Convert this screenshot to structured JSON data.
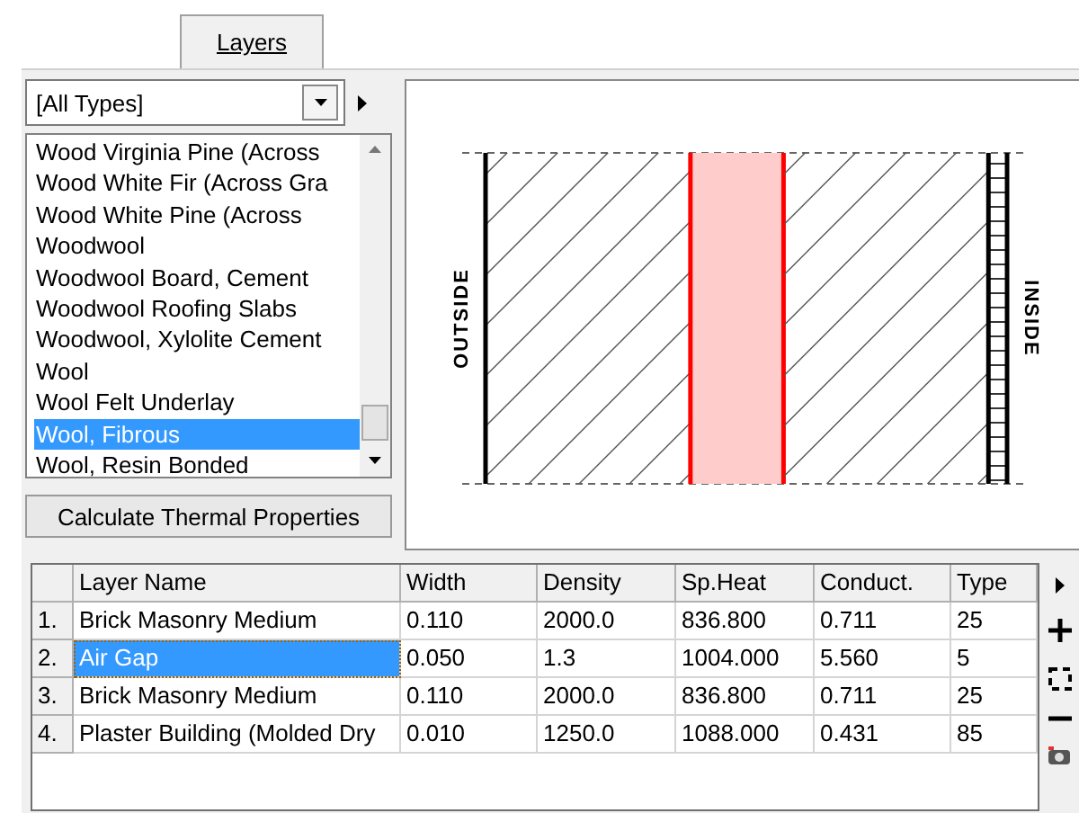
{
  "tabs": [
    {
      "label": "Layers",
      "selected": true
    }
  ],
  "type_filter": {
    "value": "[All Types]"
  },
  "materials": [
    {
      "label": "Wood Virginia Pine (Across",
      "selected": false
    },
    {
      "label": "Wood White Fir (Across Gra",
      "selected": false
    },
    {
      "label": "Wood White Pine (Across",
      "selected": false
    },
    {
      "label": "Woodwool",
      "selected": false
    },
    {
      "label": "Woodwool Board, Cement",
      "selected": false
    },
    {
      "label": "Woodwool Roofing Slabs",
      "selected": false
    },
    {
      "label": "Woodwool, Xylolite Cement",
      "selected": false
    },
    {
      "label": "Wool",
      "selected": false
    },
    {
      "label": "Wool Felt Underlay",
      "selected": false
    },
    {
      "label": "Wool, Fibrous",
      "selected": true
    },
    {
      "label": "Wool, Resin Bonded",
      "selected": false
    }
  ],
  "calculate_button": "Calculate Thermal Properties",
  "section": {
    "outside_label": "OUTSIDE",
    "inside_label": "INSIDE"
  },
  "table": {
    "columns": [
      "Layer Name",
      "Width",
      "Density",
      "Sp.Heat",
      "Conduct.",
      "Type"
    ],
    "rows": [
      {
        "index": "1.",
        "kind": "masonry",
        "selected": false,
        "cells": [
          "Brick Masonry Medium",
          "0.110",
          "2000.0",
          "836.800",
          "0.711",
          "25"
        ]
      },
      {
        "index": "2.",
        "kind": "gap",
        "selected": true,
        "cells": [
          "Air Gap",
          "0.050",
          "1.3",
          "1004.000",
          "5.560",
          "5"
        ]
      },
      {
        "index": "3.",
        "kind": "masonry",
        "selected": false,
        "cells": [
          "Brick Masonry Medium",
          "0.110",
          "2000.0",
          "836.800",
          "0.711",
          "25"
        ]
      },
      {
        "index": "4.",
        "kind": "plaster",
        "selected": false,
        "cells": [
          "Plaster Building (Molded Dry",
          "0.010",
          "1250.0",
          "1088.000",
          "0.431",
          "85"
        ]
      }
    ]
  }
}
